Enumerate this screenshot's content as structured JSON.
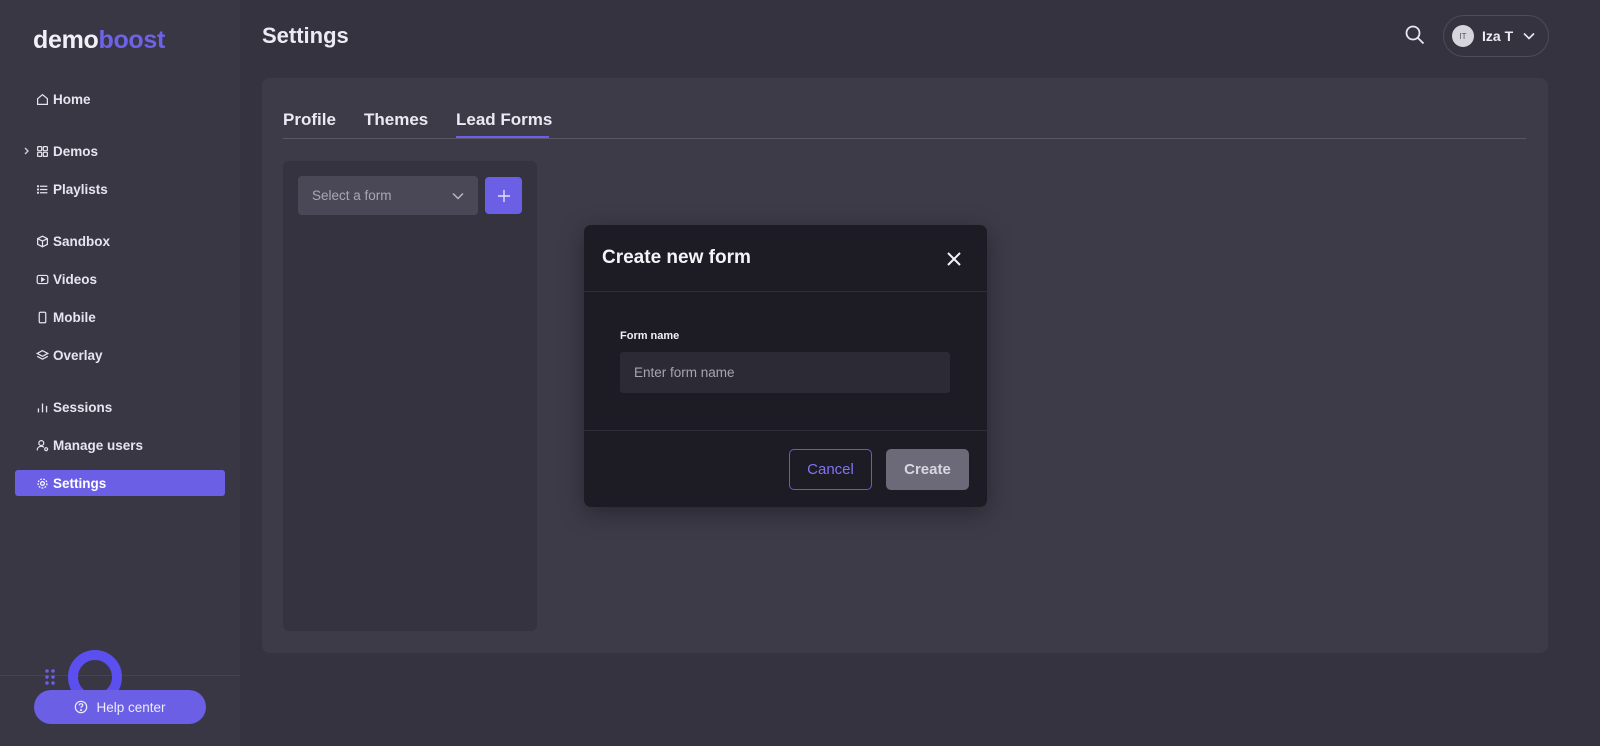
{
  "app": {
    "logo_part1": "demo",
    "logo_part2": "boost",
    "brand_color": "#6b5fe6"
  },
  "sidebar": {
    "items": [
      {
        "label": "Home",
        "icon": "home-icon"
      },
      {
        "label": "Demos",
        "icon": "grid-icon"
      },
      {
        "label": "Playlists",
        "icon": "list-icon"
      },
      {
        "label": "Sandbox",
        "icon": "box-icon"
      },
      {
        "label": "Videos",
        "icon": "video-icon"
      },
      {
        "label": "Mobile",
        "icon": "mobile-icon"
      },
      {
        "label": "Overlay",
        "icon": "layers-icon"
      },
      {
        "label": "Sessions",
        "icon": "bar-chart-icon"
      },
      {
        "label": "Manage users",
        "icon": "user-gear-icon"
      },
      {
        "label": "Settings",
        "icon": "gear-icon",
        "active": true
      }
    ],
    "help_label": "Help center"
  },
  "header": {
    "title": "Settings",
    "user": {
      "initials": "IT",
      "name": "Iza T"
    }
  },
  "tabs": [
    {
      "label": "Profile"
    },
    {
      "label": "Themes"
    },
    {
      "label": "Lead Forms",
      "active": true
    }
  ],
  "lead_forms": {
    "select_placeholder": "Select a form"
  },
  "modal": {
    "title": "Create new form",
    "field_label": "Form name",
    "field_placeholder": "Enter form name",
    "field_value": "",
    "cancel_label": "Cancel",
    "create_label": "Create"
  }
}
